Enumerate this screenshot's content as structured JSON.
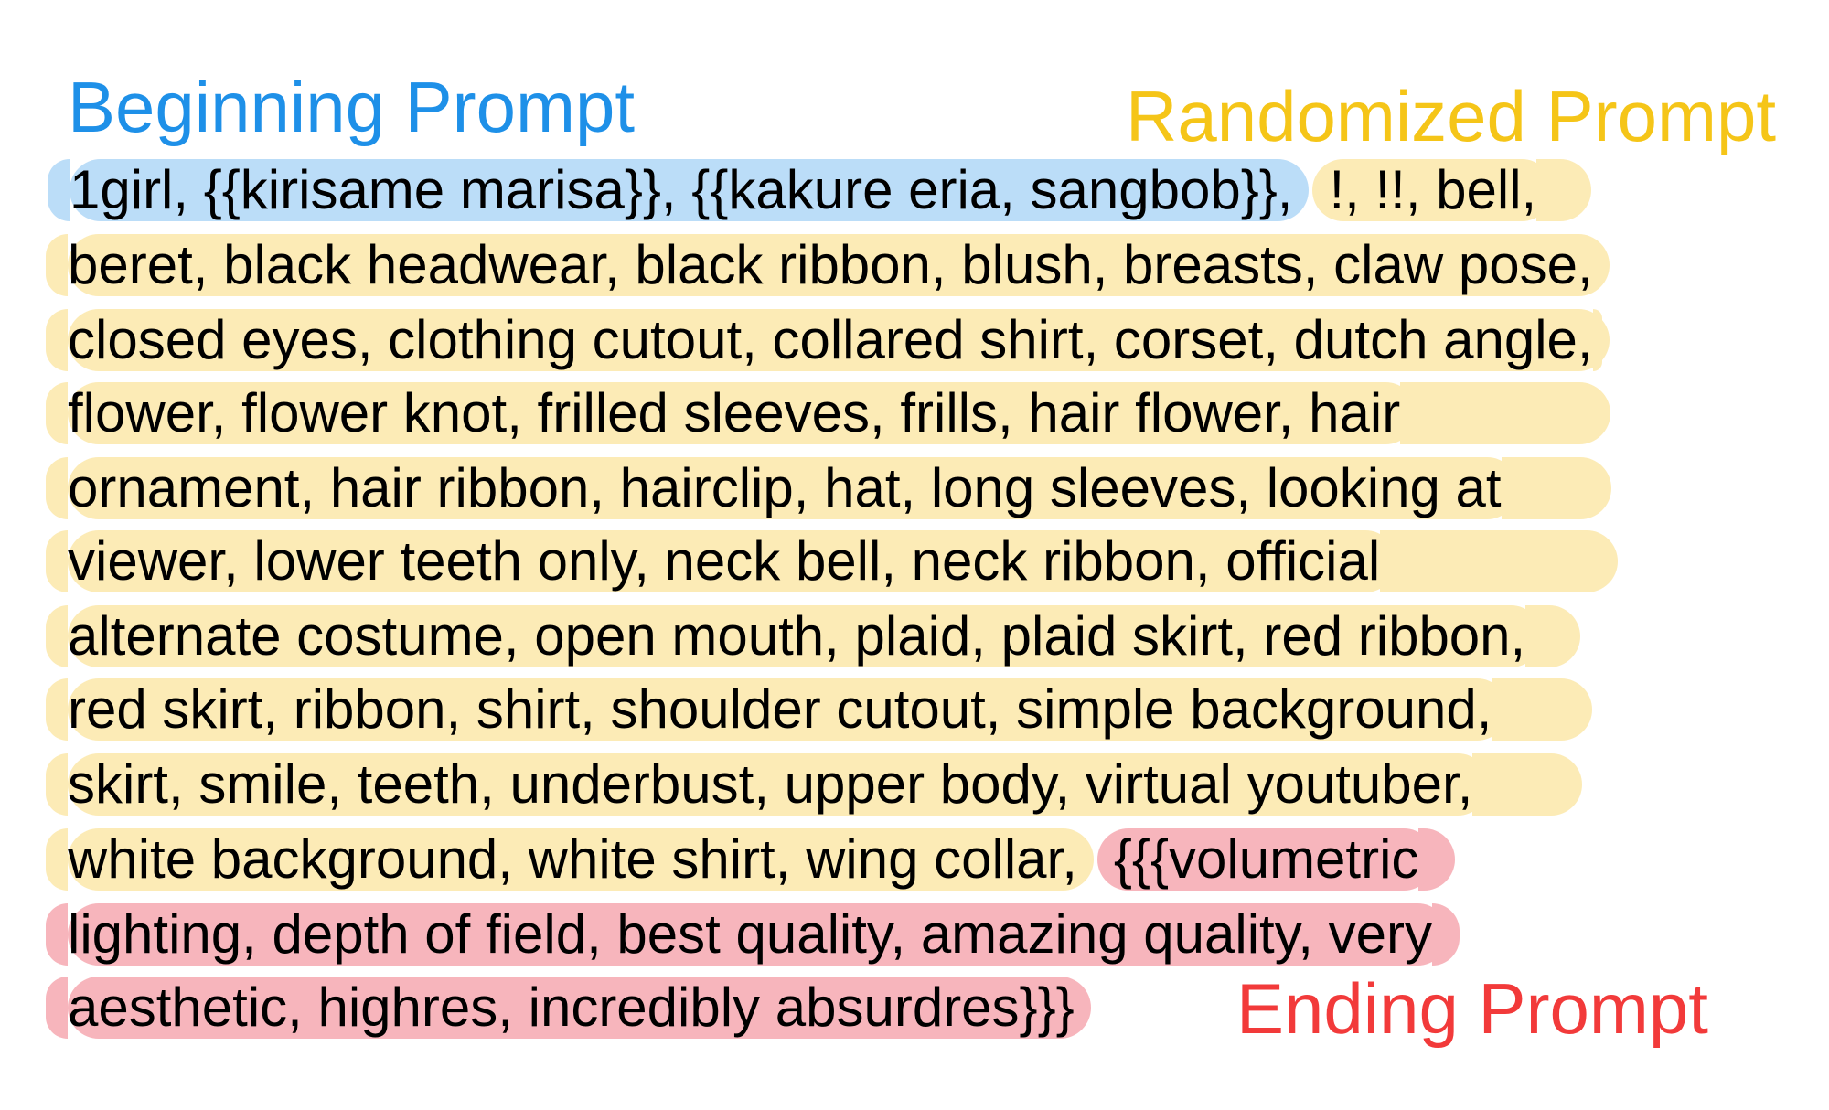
{
  "labels": {
    "beginning": "Beginning Prompt",
    "randomized": "Randomized Prompt",
    "ending": "Ending Prompt"
  },
  "colors": {
    "beginning_text": "#1E90E8",
    "randomized_text": "#F5C518",
    "ending_text": "#F23A3A",
    "beginning_highlight": "#BBDDF8",
    "randomized_highlight": "#FCEBB6",
    "ending_highlight": "#F7B5BC"
  },
  "lines": [
    [
      {
        "kind": "beginning",
        "text": "1girl, {{kirisame marisa}}, {{kakure eria, sangbob}},"
      },
      {
        "kind": "randomized",
        "text": "!, !!, bell,"
      }
    ],
    [
      {
        "kind": "randomized",
        "text": "beret, black headwear, black ribbon, blush, breasts, claw pose,"
      }
    ],
    [
      {
        "kind": "randomized",
        "text": "closed eyes, clothing cutout, collared shirt, corset, dutch angle,"
      }
    ],
    [
      {
        "kind": "randomized",
        "text": "flower, flower knot, frilled sleeves, frills, hair flower, hair"
      }
    ],
    [
      {
        "kind": "randomized",
        "text": "ornament, hair ribbon, hairclip, hat, long sleeves, looking at"
      }
    ],
    [
      {
        "kind": "randomized",
        "text": "viewer, lower teeth only, neck bell, neck ribbon, official"
      }
    ],
    [
      {
        "kind": "randomized",
        "text": "alternate costume, open mouth, plaid, plaid skirt, red ribbon,"
      }
    ],
    [
      {
        "kind": "randomized",
        "text": "red skirt, ribbon, shirt, shoulder cutout, simple background,"
      }
    ],
    [
      {
        "kind": "randomized",
        "text": "skirt, smile, teeth, underbust, upper body, virtual youtuber,"
      }
    ],
    [
      {
        "kind": "randomized",
        "text": "white background, white shirt, wing collar,"
      },
      {
        "kind": "ending",
        "text": "{{{volumetric"
      }
    ],
    [
      {
        "kind": "ending",
        "text": "lighting, depth of field, best quality, amazing quality, very"
      }
    ],
    [
      {
        "kind": "ending",
        "text": "aesthetic, highres, incredibly absurdres}}}"
      }
    ]
  ]
}
